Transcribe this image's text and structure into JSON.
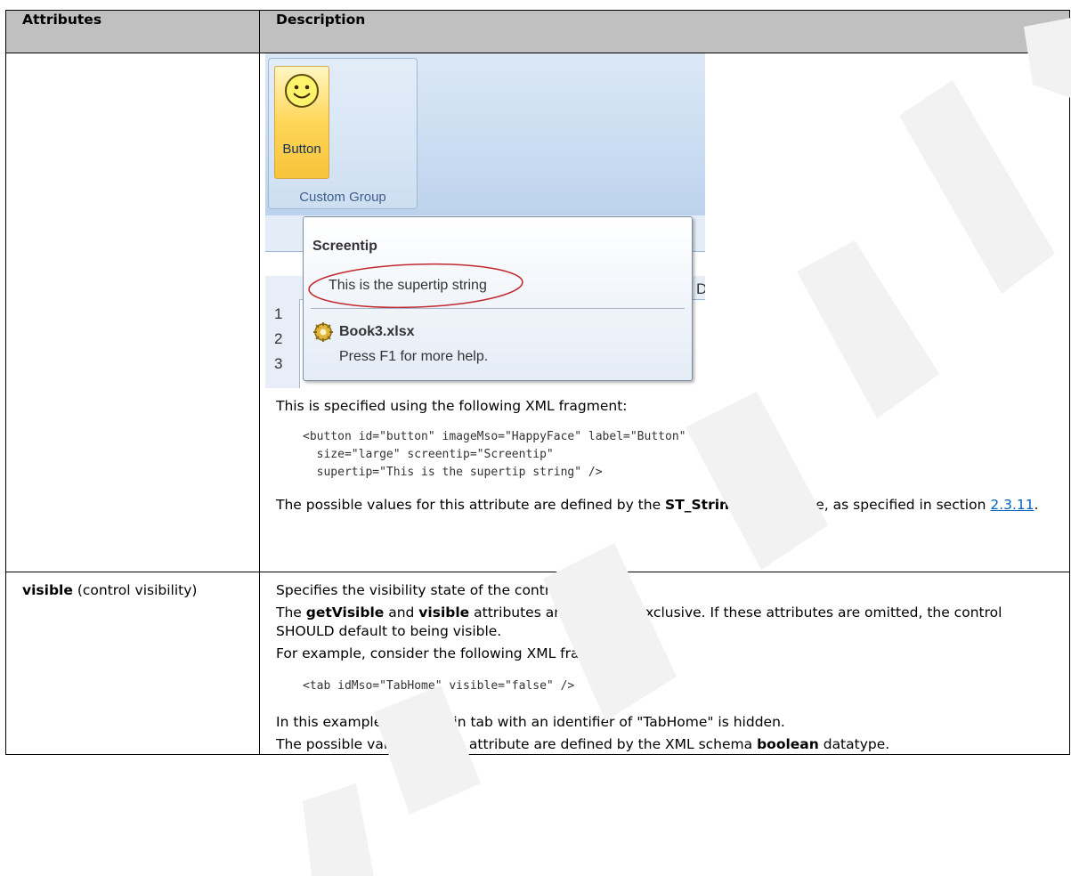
{
  "table": {
    "headers": [
      "Attributes",
      "Description"
    ]
  },
  "screenshot": {
    "button_label": "Button",
    "group_label": "Custom Group",
    "tooltip_title": "Screentip",
    "tooltip_supertip": "This is the supertip string",
    "tooltip_file": "Book3.xlsx",
    "tooltip_help": "Press F1 for more help.",
    "row_numbers": [
      "1",
      "2",
      "3"
    ],
    "column_letter": "D",
    "colors": {
      "button_fill": "#ffd658",
      "ribbon": "#c9dcf1",
      "ellipse": "#c0282d"
    }
  },
  "row1": {
    "intro": "This is specified using the following XML fragment:",
    "code_lines": [
      "<button id=\"button\" imageMso=\"HappyFace\" label=\"Button\"",
      "  size=\"large\" screentip=\"Screentip\"",
      "  supertip=\"This is the supertip string\" />"
    ],
    "values_before": "The possible values for this attribute are defined by the ",
    "values_bold": "ST_String",
    "values_after": " simple type, as specified in section ",
    "section_link": "2.3.11",
    "values_end": "."
  },
  "row2": {
    "attr_name": "visible",
    "attr_desc": " (control visibility)",
    "p1": "Specifies the visibility state of the control.",
    "p2_a": "The ",
    "p2_b": "getVisible",
    "p2_c": " and ",
    "p2_d": "visible",
    "p2_e": " attributes are mutually exclusive. If these attributes are omitted, the control SHOULD default to being visible.",
    "p3": "For example, consider the following XML fragment:",
    "code": "<tab idMso=\"TabHome\" visible=\"false\" />",
    "p4": "In this example, the built-in tab with an identifier of \"TabHome\" is hidden.",
    "p5_a": "The possible values for this attribute are defined by the XML schema ",
    "p5_b": "boolean",
    "p5_c": " datatype."
  }
}
